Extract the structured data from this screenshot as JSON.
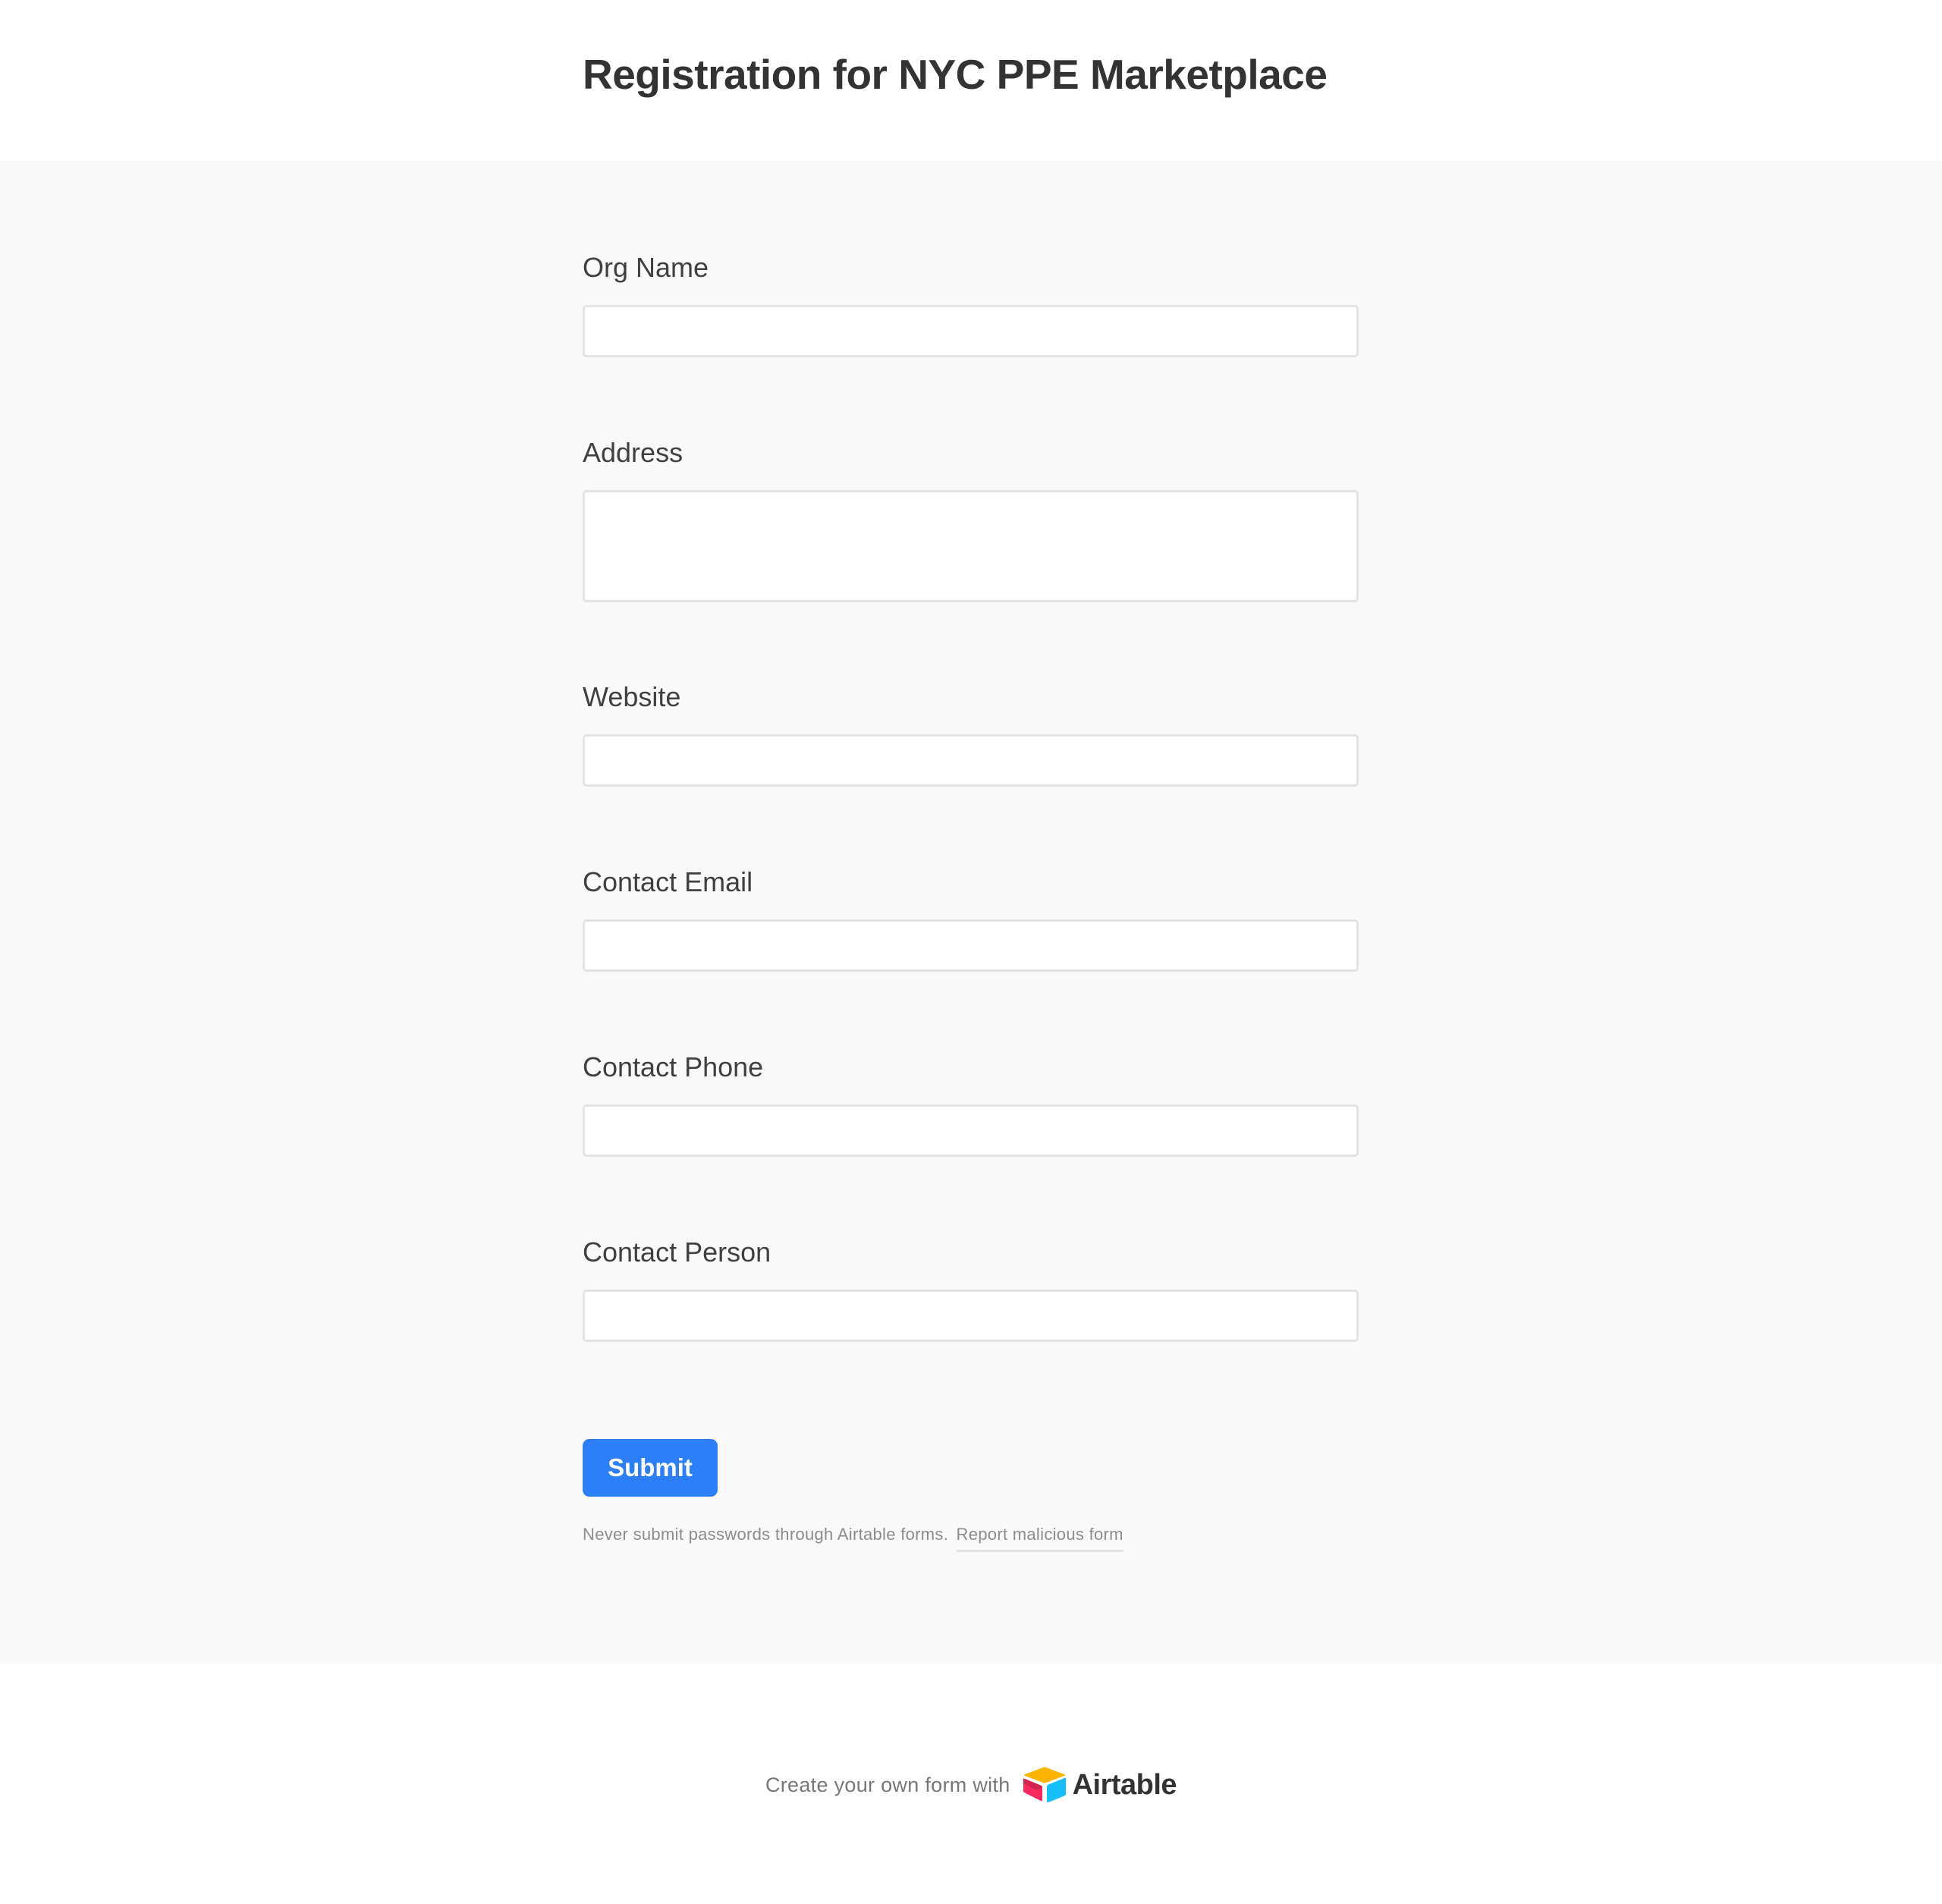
{
  "header": {
    "title": "Registration for NYC PPE Marketplace"
  },
  "form": {
    "fields": [
      {
        "label": "Org Name",
        "value": "",
        "type": "text"
      },
      {
        "label": "Address",
        "value": "",
        "type": "textarea"
      },
      {
        "label": "Website",
        "value": "",
        "type": "text"
      },
      {
        "label": "Contact Email",
        "value": "",
        "type": "text"
      },
      {
        "label": "Contact Phone",
        "value": "",
        "type": "text"
      },
      {
        "label": "Contact Person",
        "value": "",
        "type": "text"
      }
    ],
    "submit_label": "Submit",
    "disclaimer_text": "Never submit passwords through Airtable forms.",
    "report_link": "Report malicious form"
  },
  "footer": {
    "text": "Create your own form with",
    "brand": "Airtable",
    "logo_icon": "airtable-logo-icon"
  },
  "colors": {
    "accent": "#2d7ff9",
    "form_background": "#f9f9f9",
    "input_border": "#e3e3e3",
    "logo_yellow": "#fcb400",
    "logo_blue": "#18bfff",
    "logo_pink": "#f82b60"
  }
}
